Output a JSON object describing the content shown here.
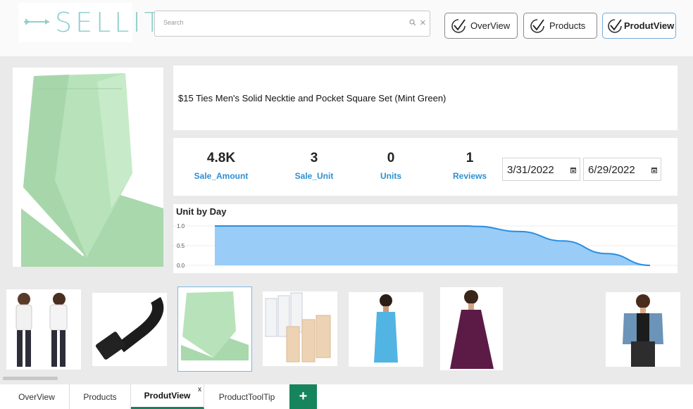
{
  "app": {
    "logo_text": "SELLIT"
  },
  "search": {
    "placeholder": "Search"
  },
  "nav": {
    "buttons": [
      "OverView",
      "Products",
      "ProdutView"
    ]
  },
  "product": {
    "title": "$15 Ties Men's Solid Necktie and Pocket Square Set (Mint Green)"
  },
  "kpis": [
    {
      "value": "4.8K",
      "label": "Sale_Amount"
    },
    {
      "value": "3",
      "label": "Sale_Unit"
    },
    {
      "value": "0",
      "label": "Units"
    },
    {
      "value": "1",
      "label": "Reviews"
    }
  ],
  "dates": {
    "start": "3/31/2022",
    "end": "6/29/2022"
  },
  "chart_data": {
    "type": "area",
    "title": "Unit by Day",
    "xlabel": "",
    "ylabel": "",
    "ylim": [
      0,
      1.0
    ],
    "yticks": [
      "1.0",
      "0.5",
      "0.0"
    ],
    "x": [
      0,
      0.2,
      0.4,
      0.58,
      0.6,
      0.7,
      0.8,
      0.9,
      1.0
    ],
    "values": [
      1.0,
      1.0,
      1.0,
      1.0,
      0.99,
      0.86,
      0.62,
      0.3,
      0.0
    ],
    "grid": true,
    "color": "#99ccf7",
    "line_color": "#2a8ee0"
  },
  "thumbnails": [
    "kids-tshirts",
    "belt",
    "necktie",
    "bra-extenders",
    "blue-dress",
    "purple-dress",
    "empty",
    "denim-vest"
  ],
  "tabs": [
    "OverView",
    "Products",
    "ProdutView",
    "ProductToolTip"
  ],
  "tab_close": "x",
  "add_tab": "+",
  "colors": {
    "accent": "#16855e",
    "kpi_label": "#2d8fd4",
    "logo": "#8fd0cf"
  }
}
